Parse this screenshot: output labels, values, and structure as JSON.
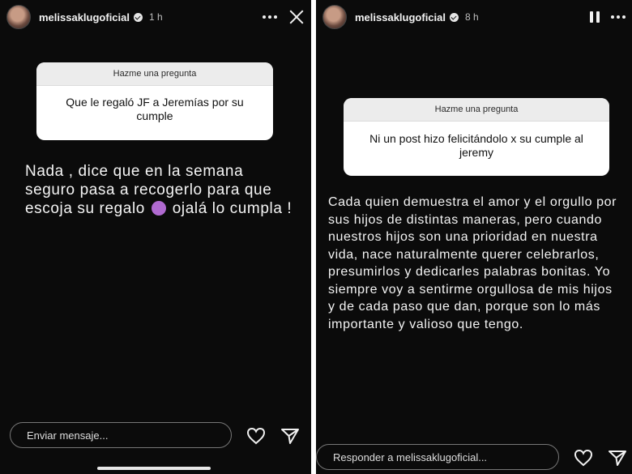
{
  "left_story": {
    "username": "melissaklugoficial",
    "time": "1 h",
    "question_header": "Hazme una pregunta",
    "question": "Que le regaló JF a Jeremías por su cumple",
    "answer_part1": "Nada , dice que en la semana seguro pasa a recogerlo para que escoja su regalo",
    "answer_part2": "ojalá lo cumpla !",
    "reply_placeholder": "Enviar mensaje..."
  },
  "right_story": {
    "username": "melissaklugoficial",
    "time": "8 h",
    "question_header": "Hazme una pregunta",
    "question": "Ni un post hizo felicitándolo x su cumple al jeremy",
    "answer": "Cada quien demuestra el amor y el orgullo por sus hijos de distintas maneras, pero cuando nuestros hijos son una prioridad en nuestra vida, nace naturalmente querer celebrarlos, presumirlos y dedicarles palabras bonitas. Yo siempre voy a sentirme orgullosa de mis hijos y de cada paso que dan, porque son lo más importante y valioso que tengo.",
    "reply_placeholder": "Responder a melissaklugoficial..."
  },
  "icons": {
    "more": "more-options-icon",
    "close": "close-icon",
    "pause": "pause-icon",
    "like": "heart-icon",
    "share": "send-icon",
    "emoji": "shrug-emoji-icon"
  },
  "colors": {
    "story_bg": "#0b0b0b",
    "question_card": "#ffffff",
    "question_header_bg": "#ececec",
    "text": "#f4f4f4"
  }
}
